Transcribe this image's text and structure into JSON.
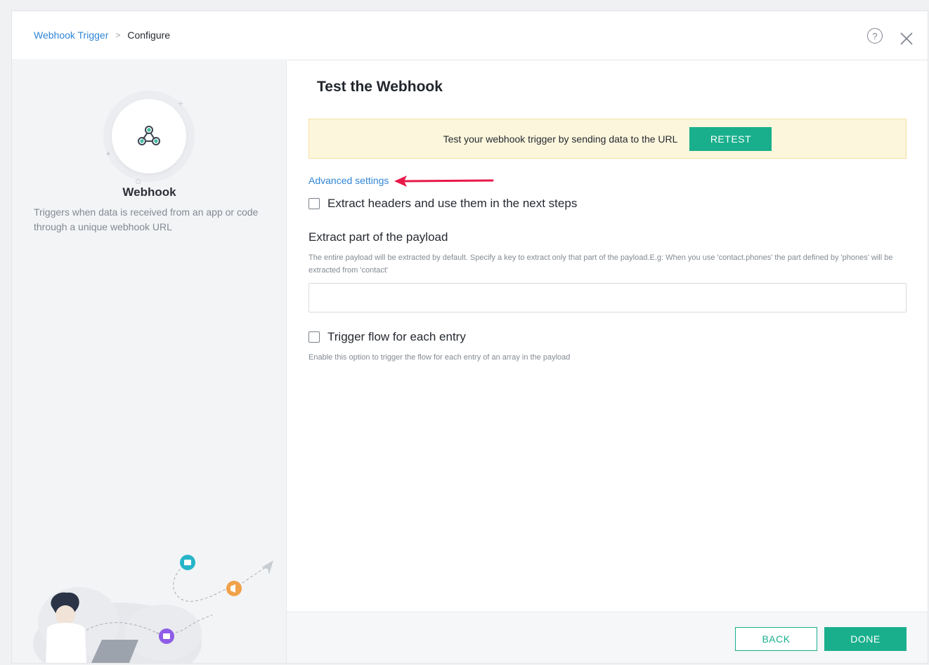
{
  "breadcrumb": {
    "parent": "Webhook Trigger",
    "separator": ">",
    "current": "Configure"
  },
  "header": {
    "help_glyph": "?",
    "help_icon": "help-icon",
    "close_icon": "close-icon"
  },
  "sidebar": {
    "app_name": "Webhook",
    "description": "Triggers when data is received from an app or code through a unique webhook URL",
    "app_icon": "webhook-icon"
  },
  "main": {
    "title": "Test the Webhook",
    "banner": {
      "text": "Test your webhook trigger by sending data to the URL",
      "button_label": "RETEST"
    },
    "advanced_settings_link": "Advanced settings",
    "extract_headers": {
      "label": "Extract headers and use them in the next steps",
      "checked": false
    },
    "extract_payload": {
      "title": "Extract part of the payload",
      "help": "The entire payload will be extracted by default. Specify a key to extract only that part of the payload.E.g: When you use 'contact.phones' the part defined by 'phones' will be extracted from 'contact'",
      "value": "",
      "placeholder": ""
    },
    "trigger_each": {
      "label": "Trigger flow for each entry",
      "help": "Enable this option to trigger the flow for each entry of an array in the payload",
      "checked": false
    }
  },
  "footer": {
    "back_label": "BACK",
    "done_label": "DONE"
  },
  "colors": {
    "accent": "#1aaf8c",
    "link": "#2f86d6",
    "arrow": "#e8194a",
    "banner_bg": "#fcf6dc"
  }
}
